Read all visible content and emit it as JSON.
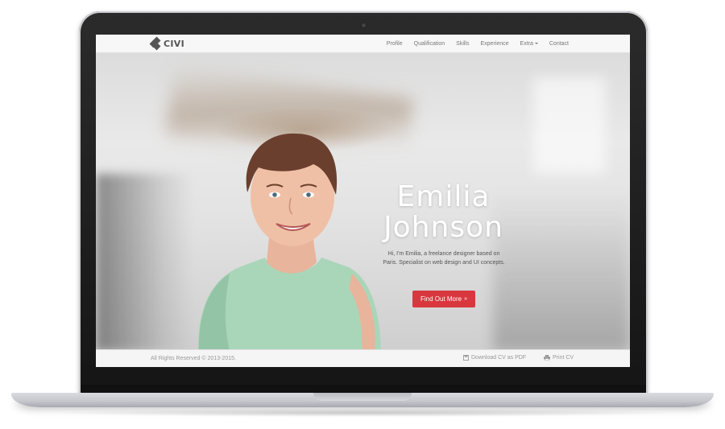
{
  "brand": {
    "name": "CIVI"
  },
  "nav": {
    "items": [
      {
        "label": "Profile"
      },
      {
        "label": "Qualification"
      },
      {
        "label": "Skills"
      },
      {
        "label": "Experience"
      },
      {
        "label": "Extra"
      },
      {
        "label": "Contact"
      }
    ]
  },
  "hero": {
    "first_name": "Emilia",
    "last_name": "Johnson",
    "description": "Hi, I'm Emilia, a freelance designer based on Paris. Specialist on web design and UI concepts.",
    "cta_label": "Find Out More",
    "cta_icon": "double-chevron-down-icon"
  },
  "footer": {
    "copyright": "All Rights Reserved © 2013-2015.",
    "download_label": "Download CV as PDF",
    "print_label": "Print CV"
  },
  "colors": {
    "accent": "#d9373e",
    "navbar_bg": "#f7f7f7",
    "footer_bg": "#f5f5f5",
    "laptop_bezel": "#1d1d1d"
  }
}
